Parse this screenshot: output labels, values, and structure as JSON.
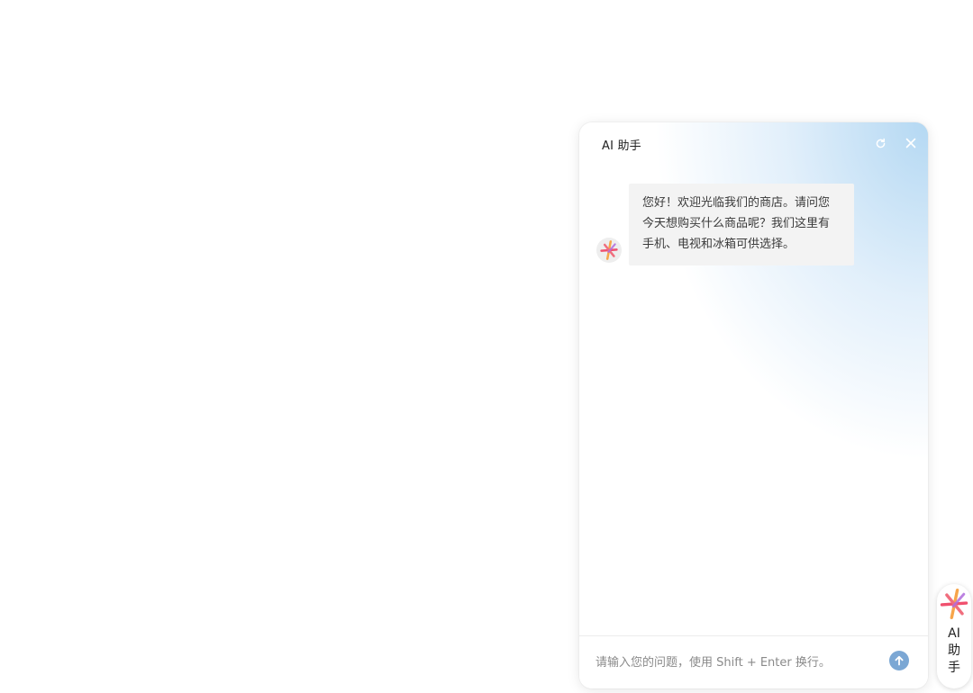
{
  "chat_panel": {
    "title": "AI 助手",
    "header_icons": [
      "refresh-icon",
      "close-icon"
    ],
    "messages": [
      {
        "role": "assistant",
        "avatar_icon": "ai-spark-icon",
        "text": "您好！欢迎光临我们的商店。请问您\n今天想购买什么商品呢？我们这里有\n手机、电视和冰箱可供选择。"
      }
    ],
    "input": {
      "value": "",
      "placeholder": "请输入您的问题，使用 Shift + Enter 换行。"
    },
    "send_icon": "arrow-up-icon"
  },
  "float_button": {
    "icon": "ai-spark-icon",
    "label": "AI\n助\n手"
  },
  "colors": {
    "panel_gradient": "#b0d6f2",
    "bubble_bg": "#f3f3f3",
    "send_button": "#7ba7d4",
    "spark_pink": "#f0506e",
    "spark_orange": "#f7a54a",
    "spark_purple": "#b06cdc"
  }
}
